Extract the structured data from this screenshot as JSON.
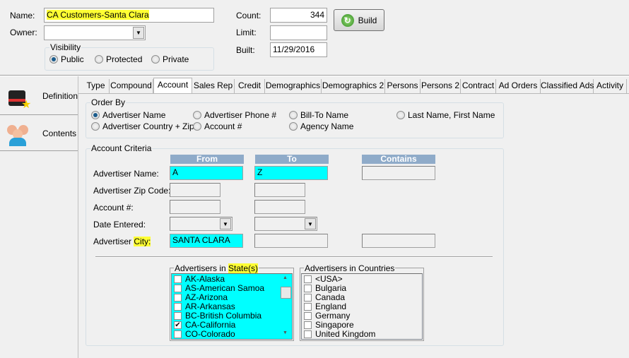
{
  "header": {
    "name_label": "Name:",
    "name_value": "CA Customers-Santa Clara",
    "owner_label": "Owner:",
    "owner_value": "",
    "visibility_label": "Visibility",
    "visibility_options": [
      "Public",
      "Protected",
      "Private"
    ],
    "visibility_selected": "Public",
    "count_label": "Count:",
    "count_value": "344",
    "limit_label": "Limit:",
    "limit_value": "",
    "built_label": "Built:",
    "built_value": "11/29/2016",
    "build_button": "Build"
  },
  "sidebar": {
    "items": [
      {
        "label": "Definition",
        "icon": "magic-hat-icon"
      },
      {
        "label": "Contents",
        "icon": "users-icon"
      }
    ]
  },
  "tabs": [
    "Type",
    "Compound",
    "Account",
    "Sales Rep",
    "Credit",
    "Demographics",
    "Demographics 2",
    "Persons",
    "Persons 2",
    "Contract",
    "Ad Orders",
    "Classified Ads",
    "Activity"
  ],
  "active_tab": "Account",
  "order_by": {
    "title": "Order By",
    "options": [
      "Advertiser Name",
      "Advertiser Phone #",
      "Bill-To Name",
      "Last Name, First Name",
      "Advertiser Country + Zip",
      "Account #",
      "Agency Name"
    ],
    "selected": "Advertiser Name"
  },
  "criteria": {
    "title": "Account Criteria",
    "headers": [
      "From",
      "To",
      "Contains"
    ],
    "rows": [
      {
        "label": "Advertiser Name:",
        "from": "A",
        "to": "Z",
        "contains": ""
      },
      {
        "label": "Advertiser Zip Code:",
        "from": "",
        "to": ""
      },
      {
        "label": "Account #:",
        "from": "",
        "to": ""
      },
      {
        "label": "Date Entered:",
        "from": "",
        "to": ""
      },
      {
        "label_a": "Advertiser ",
        "label_b": "City:",
        "from": "SANTA CLARA",
        "to": "",
        "contains": ""
      }
    ]
  },
  "states": {
    "title_a": "Advertisers in ",
    "title_b": "State(s)",
    "items": [
      {
        "label": "AK-Alaska",
        "checked": false
      },
      {
        "label": "AS-American Samoa",
        "checked": false
      },
      {
        "label": "AZ-Arizona",
        "checked": false
      },
      {
        "label": "AR-Arkansas",
        "checked": false
      },
      {
        "label": "BC-British Columbia",
        "checked": false
      },
      {
        "label": "CA-California",
        "checked": true
      },
      {
        "label": "CO-Colorado",
        "checked": false
      }
    ]
  },
  "countries": {
    "title": "Advertisers in Countries",
    "items": [
      "<USA>",
      "Bulgaria",
      "Canada",
      "England",
      "Germany",
      "Singapore",
      "United Kingdom"
    ]
  },
  "colors": {
    "highlight": "#ffff33",
    "field_cyan": "#00ffff",
    "header_blue": "#8fabc9"
  }
}
